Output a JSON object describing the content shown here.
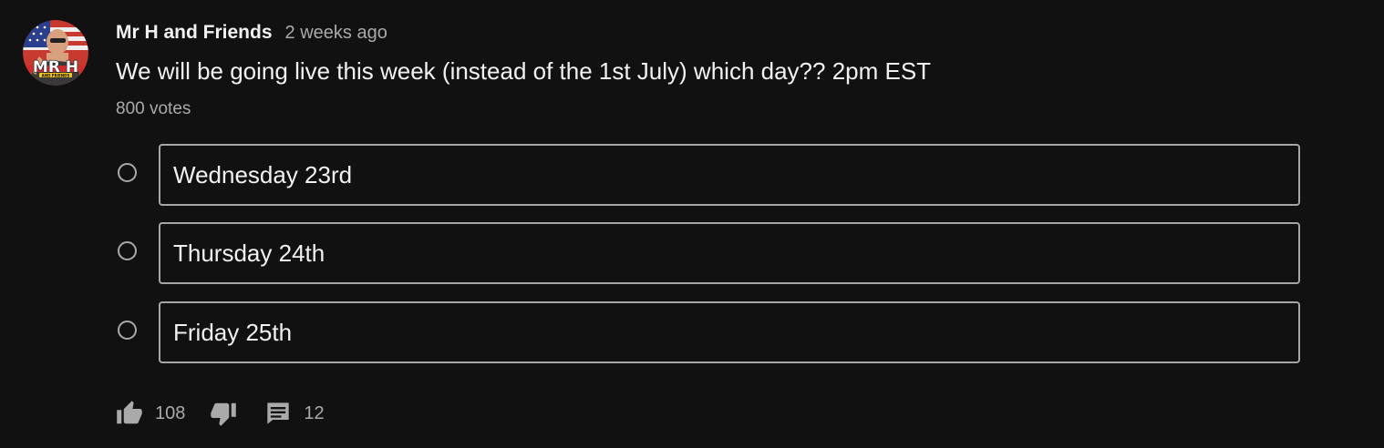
{
  "post": {
    "author": "Mr H and Friends",
    "time": "2 weeks ago",
    "avatar": {
      "icon": "channel-avatar",
      "logo_text": "MR H",
      "logo_subtext": "AND FRIENDS"
    }
  },
  "poll": {
    "question": "We will be going live this week (instead of the 1st July) which day?? 2pm EST",
    "votes": "800 votes",
    "options": [
      {
        "label": "Wednesday 23rd"
      },
      {
        "label": "Thursday 24th"
      },
      {
        "label": "Friday 25th"
      }
    ]
  },
  "actions": {
    "like_icon": "thumbs-up-icon",
    "like_count": "108",
    "dislike_icon": "thumbs-down-icon",
    "comment_icon": "comment-icon",
    "comment_count": "12"
  },
  "colors": {
    "background": "#111111",
    "text_primary": "#f1f1f1",
    "text_secondary": "#aaaaaa",
    "option_border": "#a6a6a6"
  }
}
